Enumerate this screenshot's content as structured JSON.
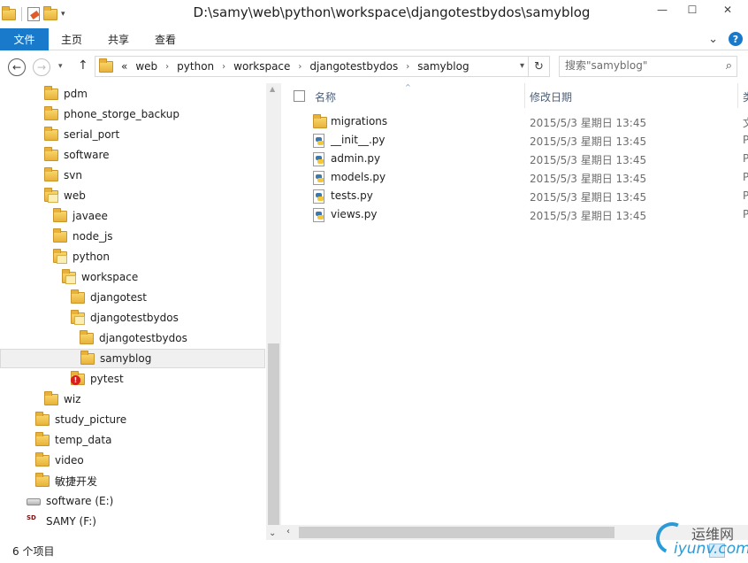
{
  "window": {
    "title": "D:\\samy\\web\\python\\workspace\\djangotestbydos\\samyblog",
    "minimize": "—",
    "maximize": "☐",
    "close": "✕"
  },
  "ribbon": {
    "tabs": [
      "文件",
      "主页",
      "共享",
      "查看"
    ],
    "expand": "⌄",
    "help": "?"
  },
  "address": {
    "overflow": "«",
    "crumbs": [
      "web",
      "python",
      "workspace",
      "djangotestbydos",
      "samyblog"
    ],
    "crumb_sep": "›",
    "refresh": "↻"
  },
  "search": {
    "placeholder": "搜索\"samyblog\"",
    "icon": "search-icon"
  },
  "nav": {
    "items": [
      {
        "label": "pdm",
        "indent": 1,
        "icon": "folder"
      },
      {
        "label": "phone_storge_backup",
        "indent": 1,
        "icon": "folder"
      },
      {
        "label": "serial_port",
        "indent": 1,
        "icon": "folder"
      },
      {
        "label": "software",
        "indent": 1,
        "icon": "folder"
      },
      {
        "label": "svn",
        "indent": 1,
        "icon": "folder"
      },
      {
        "label": "web",
        "indent": 1,
        "icon": "folder-open"
      },
      {
        "label": "javaee",
        "indent": 2,
        "icon": "folder"
      },
      {
        "label": "node_js",
        "indent": 2,
        "icon": "folder"
      },
      {
        "label": "python",
        "indent": 2,
        "icon": "folder-open"
      },
      {
        "label": "workspace",
        "indent": 3,
        "icon": "folder-open"
      },
      {
        "label": "djangotest",
        "indent": 4,
        "icon": "folder"
      },
      {
        "label": "djangotestbydos",
        "indent": 4,
        "icon": "folder-open"
      },
      {
        "label": "djangotestbydos",
        "indent": 5,
        "icon": "folder"
      },
      {
        "label": "samyblog",
        "indent": 5,
        "icon": "folder",
        "selected": true
      },
      {
        "label": "pytest",
        "indent": 4,
        "icon": "folder-warning"
      },
      {
        "label": "wiz",
        "indent": 1,
        "icon": "folder"
      },
      {
        "label": "study_picture",
        "indent": 0,
        "icon": "folder"
      },
      {
        "label": "temp_data",
        "indent": 0,
        "icon": "folder"
      },
      {
        "label": "video",
        "indent": 0,
        "icon": "folder"
      },
      {
        "label": "敏捷开发",
        "indent": 0,
        "icon": "folder"
      },
      {
        "label": "software (E:)",
        "indent": -1,
        "icon": "drive"
      },
      {
        "label": "SAMY (F:)",
        "indent": -1,
        "icon": "sd-card"
      }
    ]
  },
  "columns": {
    "name": "名称",
    "date": "修改日期",
    "type": "类"
  },
  "files": [
    {
      "name": "migrations",
      "date": "2015/5/3 星期日 13:45",
      "type": "文",
      "icon": "folder"
    },
    {
      "name": "__init__.py",
      "date": "2015/5/3 星期日 13:45",
      "type": "P",
      "icon": "python-file"
    },
    {
      "name": "admin.py",
      "date": "2015/5/3 星期日 13:45",
      "type": "P",
      "icon": "python-file"
    },
    {
      "name": "models.py",
      "date": "2015/5/3 星期日 13:45",
      "type": "P",
      "icon": "python-file"
    },
    {
      "name": "tests.py",
      "date": "2015/5/3 星期日 13:45",
      "type": "P",
      "icon": "python-file"
    },
    {
      "name": "views.py",
      "date": "2015/5/3 星期日 13:45",
      "type": "P",
      "icon": "python-file"
    }
  ],
  "status": {
    "item_count": "6 个项目"
  },
  "watermark": {
    "top": "运维网",
    "bottom": "iyunv.com"
  },
  "colors": {
    "accent": "#1979ca",
    "selected_bg": "#f0f0f0",
    "header_text": "#4c607a"
  }
}
